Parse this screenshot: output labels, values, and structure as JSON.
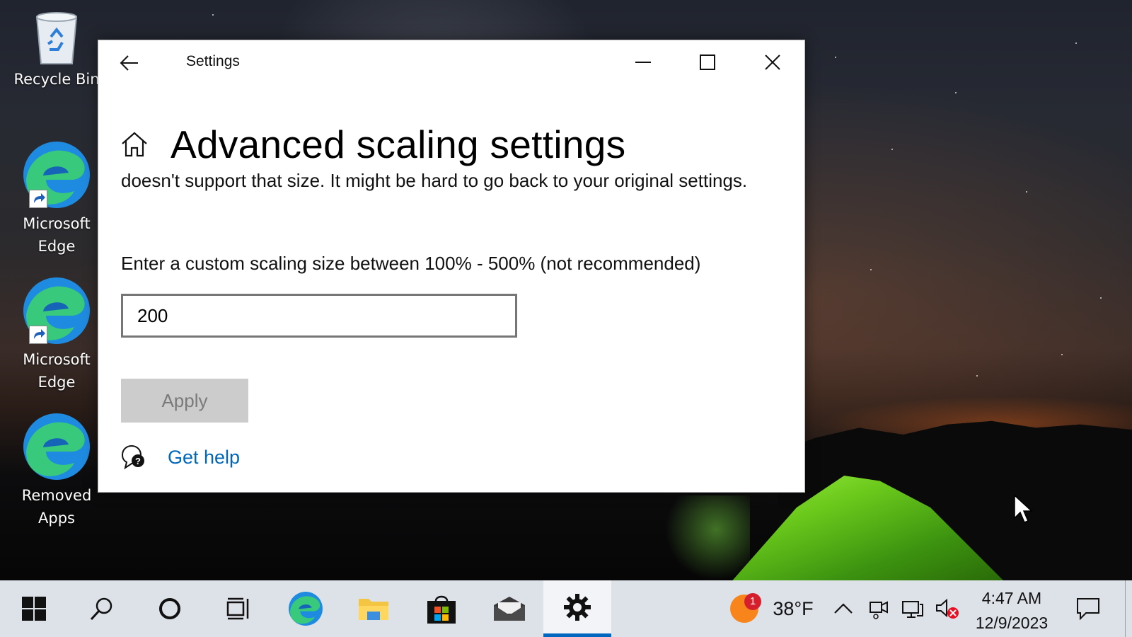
{
  "desktop": {
    "icons": [
      {
        "label": "Recycle Bin",
        "type": "recycle-bin"
      },
      {
        "label": "Microsoft Edge",
        "type": "edge"
      },
      {
        "label": "Microsoft Edge",
        "type": "edge"
      },
      {
        "label": "Removed Apps",
        "type": "edge"
      }
    ]
  },
  "window": {
    "title": "Settings",
    "page_title": "Advanced scaling settings",
    "description": "doesn't support that size. It might be hard to go back to your original settings.",
    "prompt": "Enter a custom scaling size between 100% - 500% (not recommended)",
    "input_value": "200",
    "apply_label": "Apply",
    "help_label": "Get help"
  },
  "taskbar": {
    "buttons": [
      "start",
      "search",
      "cortana",
      "task-view",
      "edge",
      "file-explorer",
      "store",
      "mail",
      "settings"
    ],
    "active": "settings",
    "weather": {
      "temperature": "38°F",
      "badge_count": "1"
    },
    "clock": {
      "time": "4:47 AM",
      "date": "12/9/2023"
    }
  },
  "colors": {
    "accent": "#0067b8",
    "taskbar": "#dde1e8",
    "active_underline": "#0067c0"
  }
}
